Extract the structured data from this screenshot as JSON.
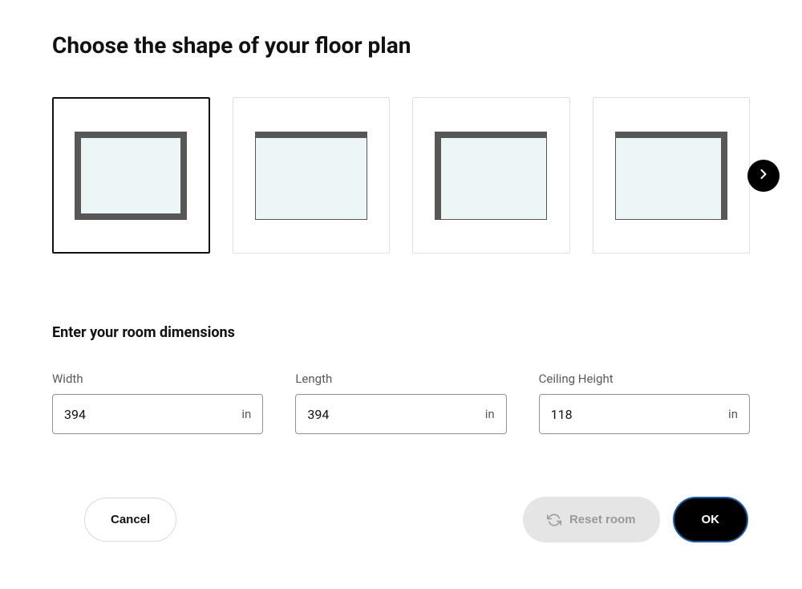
{
  "title": "Choose the shape of your floor plan",
  "shapes": [
    {
      "id": "rectangle-closed",
      "selected": true
    },
    {
      "id": "rectangle-top-open",
      "selected": false
    },
    {
      "id": "rectangle-top-left",
      "selected": false
    },
    {
      "id": "rectangle-top-right",
      "selected": false
    }
  ],
  "dimensions": {
    "title": "Enter your room dimensions",
    "fields": [
      {
        "label": "Width",
        "value": "394",
        "unit": "in"
      },
      {
        "label": "Length",
        "value": "394",
        "unit": "in"
      },
      {
        "label": "Ceiling Height",
        "value": "118",
        "unit": "in"
      }
    ]
  },
  "buttons": {
    "cancel": "Cancel",
    "reset": "Reset room",
    "ok": "OK"
  }
}
